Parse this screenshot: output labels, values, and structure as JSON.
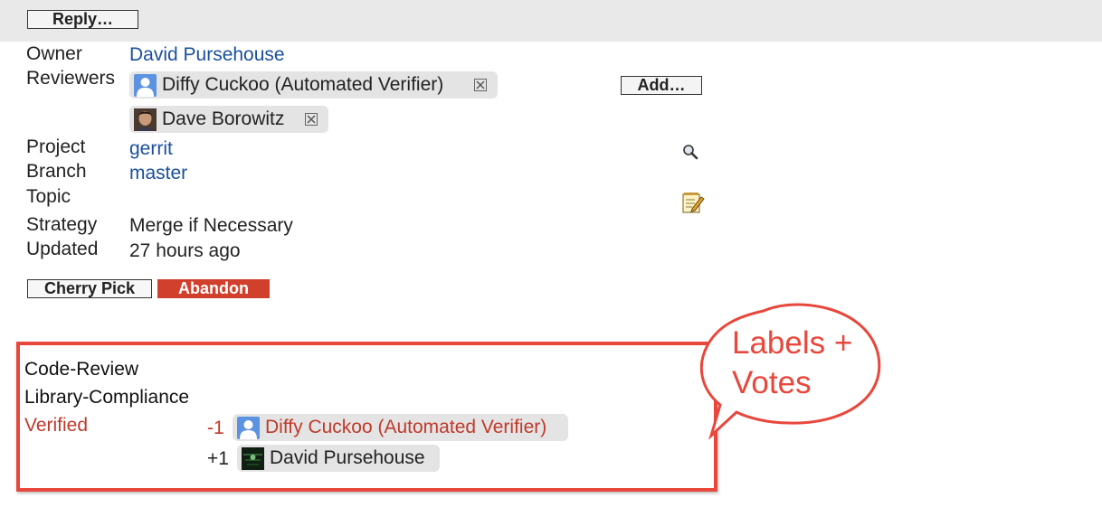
{
  "toolbar": {
    "reply_label": "Reply…"
  },
  "info": {
    "owner_label": "Owner",
    "owner_name": "David Pursehouse",
    "reviewers_label": "Reviewers",
    "reviewers": [
      {
        "name": "Diffy Cuckoo (Automated Verifier)",
        "avatar": "default-user-icon"
      },
      {
        "name": "Dave Borowitz",
        "avatar": "user-photo"
      }
    ],
    "add_label": "Add…",
    "project_label": "Project",
    "project_value": "gerrit",
    "branch_label": "Branch",
    "branch_value": "master",
    "topic_label": "Topic",
    "strategy_label": "Strategy",
    "strategy_value": "Merge if Necessary",
    "updated_label": "Updated",
    "updated_value": "27 hours ago"
  },
  "actions": {
    "cherry_pick_label": "Cherry Pick",
    "abandon_label": "Abandon"
  },
  "labels": {
    "code_review": "Code-Review",
    "library_compliance": "Library-Compliance",
    "verified": "Verified",
    "verified_votes": [
      {
        "score": "-1",
        "name": "Diffy Cuckoo (Automated Verifier)"
      },
      {
        "score": "+1",
        "name": "David Pursehouse"
      }
    ]
  },
  "callout": {
    "line1": "Labels +",
    "line2": "Votes"
  },
  "colors": {
    "link": "#1a4f9c",
    "abandon_bg": "#d1402d",
    "rejected": "#c0392b",
    "annotation": "#e8473c",
    "chip_bg": "#e4e4e4",
    "topbar_bg": "#e9e9e9"
  }
}
